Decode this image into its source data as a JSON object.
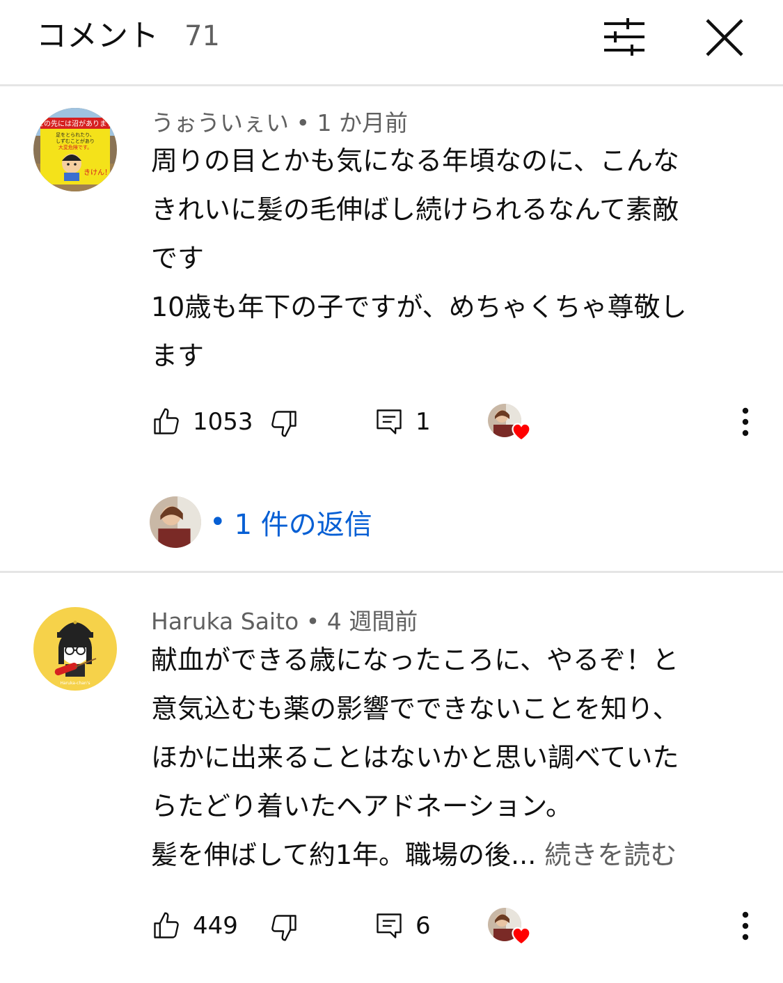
{
  "header": {
    "title": "コメント",
    "count": "71",
    "filter_icon": "tune-icon",
    "close_icon": "close-icon"
  },
  "comments": [
    {
      "author": "うぉういぇい",
      "time": "1 か月前",
      "lines": [
        "周りの目とかも気になる年頃なのに、こんな",
        "きれいに髪の毛伸ばし続けられるなんて素敵",
        "です",
        "10歳も年下の子ですが、めちゃくちゃ尊敬し",
        "ます"
      ],
      "likes": "1053",
      "reply_count": "1",
      "replies_label": "1 件の返信"
    },
    {
      "author": "Haruka Saito",
      "time": "4 週間前",
      "lines": [
        "献血ができる歳になったころに、やるぞ！と",
        "意気込むも薬の影響でできないことを知り、",
        "ほかに出来ることはないかと思い調べていた",
        "らたどり着いたヘアドネーション。",
        "髪を伸ばして約1年。職場の後..."
      ],
      "read_more": "続きを読む",
      "likes": "449",
      "reply_count": "6"
    }
  ],
  "avatar1_sign": {
    "banner": "この先には沼があります",
    "line1": "足をとられたり、",
    "line2": "しずむことがあり",
    "line3": "大変危険です。",
    "warn": "きけん！"
  },
  "avatar2_caption": "Haruka-chan's",
  "icons": {
    "like": "thumb-up-icon",
    "dislike": "thumb-down-icon",
    "reply": "comment-icon",
    "more": "more-vert-icon",
    "heart": "creator-heart-icon"
  },
  "colors": {
    "link": "#065fd4",
    "heart": "#ff0000",
    "muted": "#606060",
    "avatar2_bg": "#f6d24a"
  }
}
